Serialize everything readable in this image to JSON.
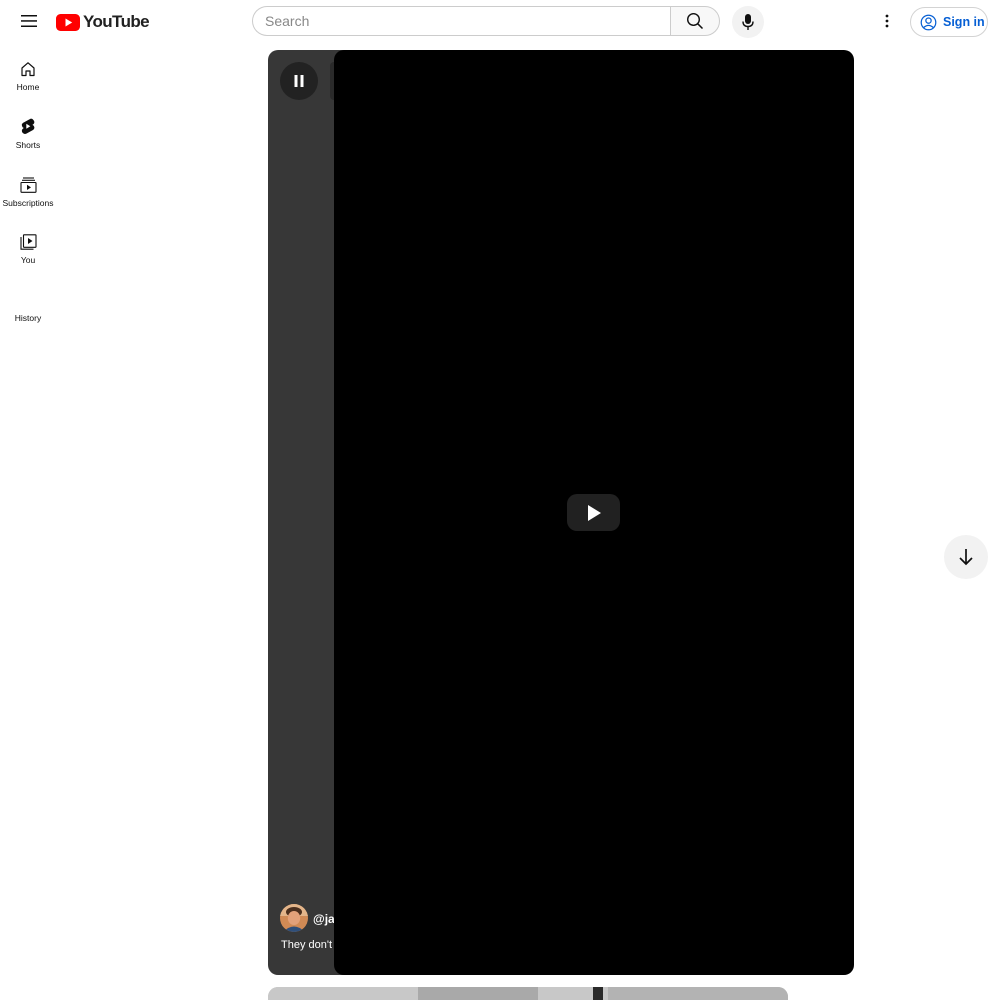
{
  "header": {
    "logo_text": "YouTube",
    "search_placeholder": "Search",
    "sign_in_label": "Sign in"
  },
  "sidebar": {
    "items": [
      {
        "label": "Home",
        "icon": "home-icon"
      },
      {
        "label": "Shorts",
        "icon": "shorts-icon"
      },
      {
        "label": "Subscriptions",
        "icon": "subscriptions-icon"
      },
      {
        "label": "You",
        "icon": "you-icon"
      },
      {
        "label": "History",
        "icon": ""
      }
    ]
  },
  "short": {
    "channel": "@jan",
    "caption": "They don't"
  },
  "colors": {
    "brand_red": "#ff0000",
    "link_blue": "#065fd4",
    "player_bg": "#000000"
  }
}
